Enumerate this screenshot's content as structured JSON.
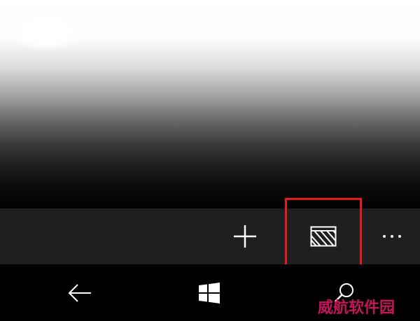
{
  "app_bar": {
    "buttons": [
      {
        "id": "add",
        "icon": "plus-icon"
      },
      {
        "id": "select",
        "icon": "select-icon",
        "highlighted": true
      },
      {
        "id": "more",
        "icon": "more-icon"
      }
    ],
    "highlight_color": "#e8191b"
  },
  "nav_bar": {
    "buttons": [
      {
        "id": "back",
        "icon": "back-arrow-icon"
      },
      {
        "id": "home",
        "icon": "windows-logo-icon"
      },
      {
        "id": "search",
        "icon": "search-icon"
      }
    ]
  },
  "watermark": {
    "text": "威航软件园",
    "color": "#c4155b"
  }
}
